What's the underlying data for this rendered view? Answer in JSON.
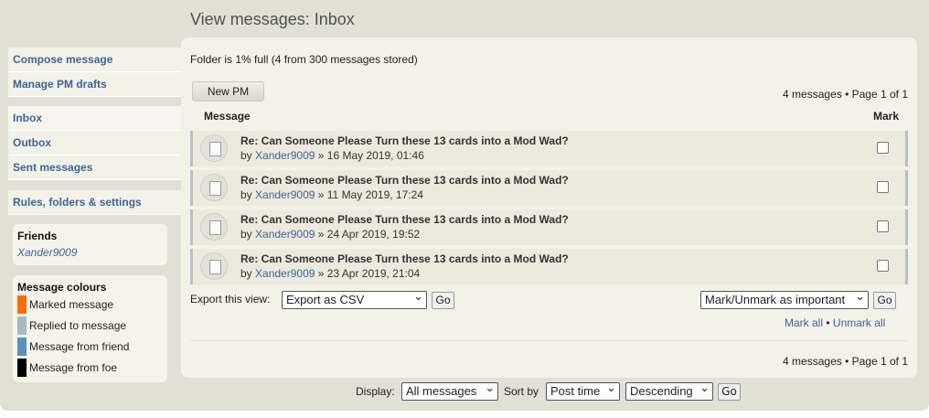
{
  "header": {
    "title": "View messages: Inbox"
  },
  "sidebar": {
    "group1": [
      {
        "label": "Compose message"
      },
      {
        "label": "Manage PM drafts"
      }
    ],
    "group2": [
      {
        "label": "Inbox"
      },
      {
        "label": "Outbox"
      },
      {
        "label": "Sent messages"
      }
    ],
    "group3": [
      {
        "label": "Rules, folders & settings"
      }
    ],
    "friends": {
      "title": "Friends",
      "items": [
        "Xander9009"
      ]
    },
    "colours": {
      "title": "Message colours",
      "items": [
        {
          "label": "Marked message",
          "color": "#ff6a00"
        },
        {
          "label": "Replied to message",
          "color": "#a9b8c2"
        },
        {
          "label": "Message from friend",
          "color": "#5c8fbb"
        },
        {
          "label": "Message from foe",
          "color": "#000000"
        }
      ]
    }
  },
  "main": {
    "folder_status": "Folder is 1% full (4 from 300 messages stored)",
    "new_pm_label": "New PM",
    "pagination": "4 messages • Page 1 of 1",
    "col_message": "Message",
    "col_mark": "Mark",
    "messages": [
      {
        "subject": "Re: Can Someone Please Turn these 13 cards into a Mod Wad?",
        "by": "by",
        "author": "Xander9009",
        "date": "» 16 May 2019, 01:46"
      },
      {
        "subject": "Re: Can Someone Please Turn these 13 cards into a Mod Wad?",
        "by": "by",
        "author": "Xander9009",
        "date": "» 11 May 2019, 17:24"
      },
      {
        "subject": "Re: Can Someone Please Turn these 13 cards into a Mod Wad?",
        "by": "by",
        "author": "Xander9009",
        "date": "» 24 Apr 2019, 19:52"
      },
      {
        "subject": "Re: Can Someone Please Turn these 13 cards into a Mod Wad?",
        "by": "by",
        "author": "Xander9009",
        "date": "» 23 Apr 2019, 21:04"
      }
    ],
    "export_label": "Export this view:",
    "export_select": "Export as CSV",
    "go_label": "Go",
    "mark_select": "Mark/Unmark as important",
    "mark_all": "Mark all",
    "separator": "•",
    "unmark_all": "Unmark all"
  },
  "footer": {
    "display_label": "Display:",
    "display_select": "All messages",
    "sort_label": "Sort by",
    "sort_select": "Post time",
    "order_select": "Descending",
    "go_label": "Go"
  }
}
